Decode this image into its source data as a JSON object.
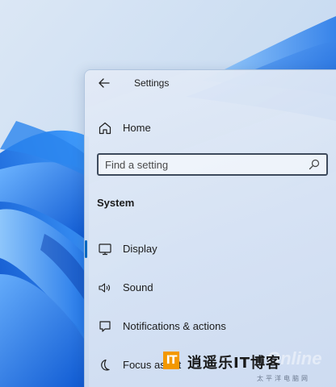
{
  "window": {
    "title": "Settings"
  },
  "nav": {
    "home_label": "Home",
    "search_placeholder": "Find a setting",
    "section_header": "System",
    "items": [
      {
        "label": "Display",
        "icon": "monitor-icon",
        "selected": true
      },
      {
        "label": "Sound",
        "icon": "speaker-icon",
        "selected": false
      },
      {
        "label": "Notifications & actions",
        "icon": "notification-icon",
        "selected": false
      },
      {
        "label": "Focus assist",
        "icon": "moon-icon",
        "selected": false
      }
    ]
  },
  "watermark": {
    "logo_letters": "IT",
    "text": "逍遥乐IT博客",
    "subtext": "太平洋电脑网",
    "ghost_text": "Online"
  },
  "colors": {
    "accent": "#0067c0",
    "wallpaper_blue": "#1f7ae0",
    "window_bg": "#dde6f4"
  }
}
